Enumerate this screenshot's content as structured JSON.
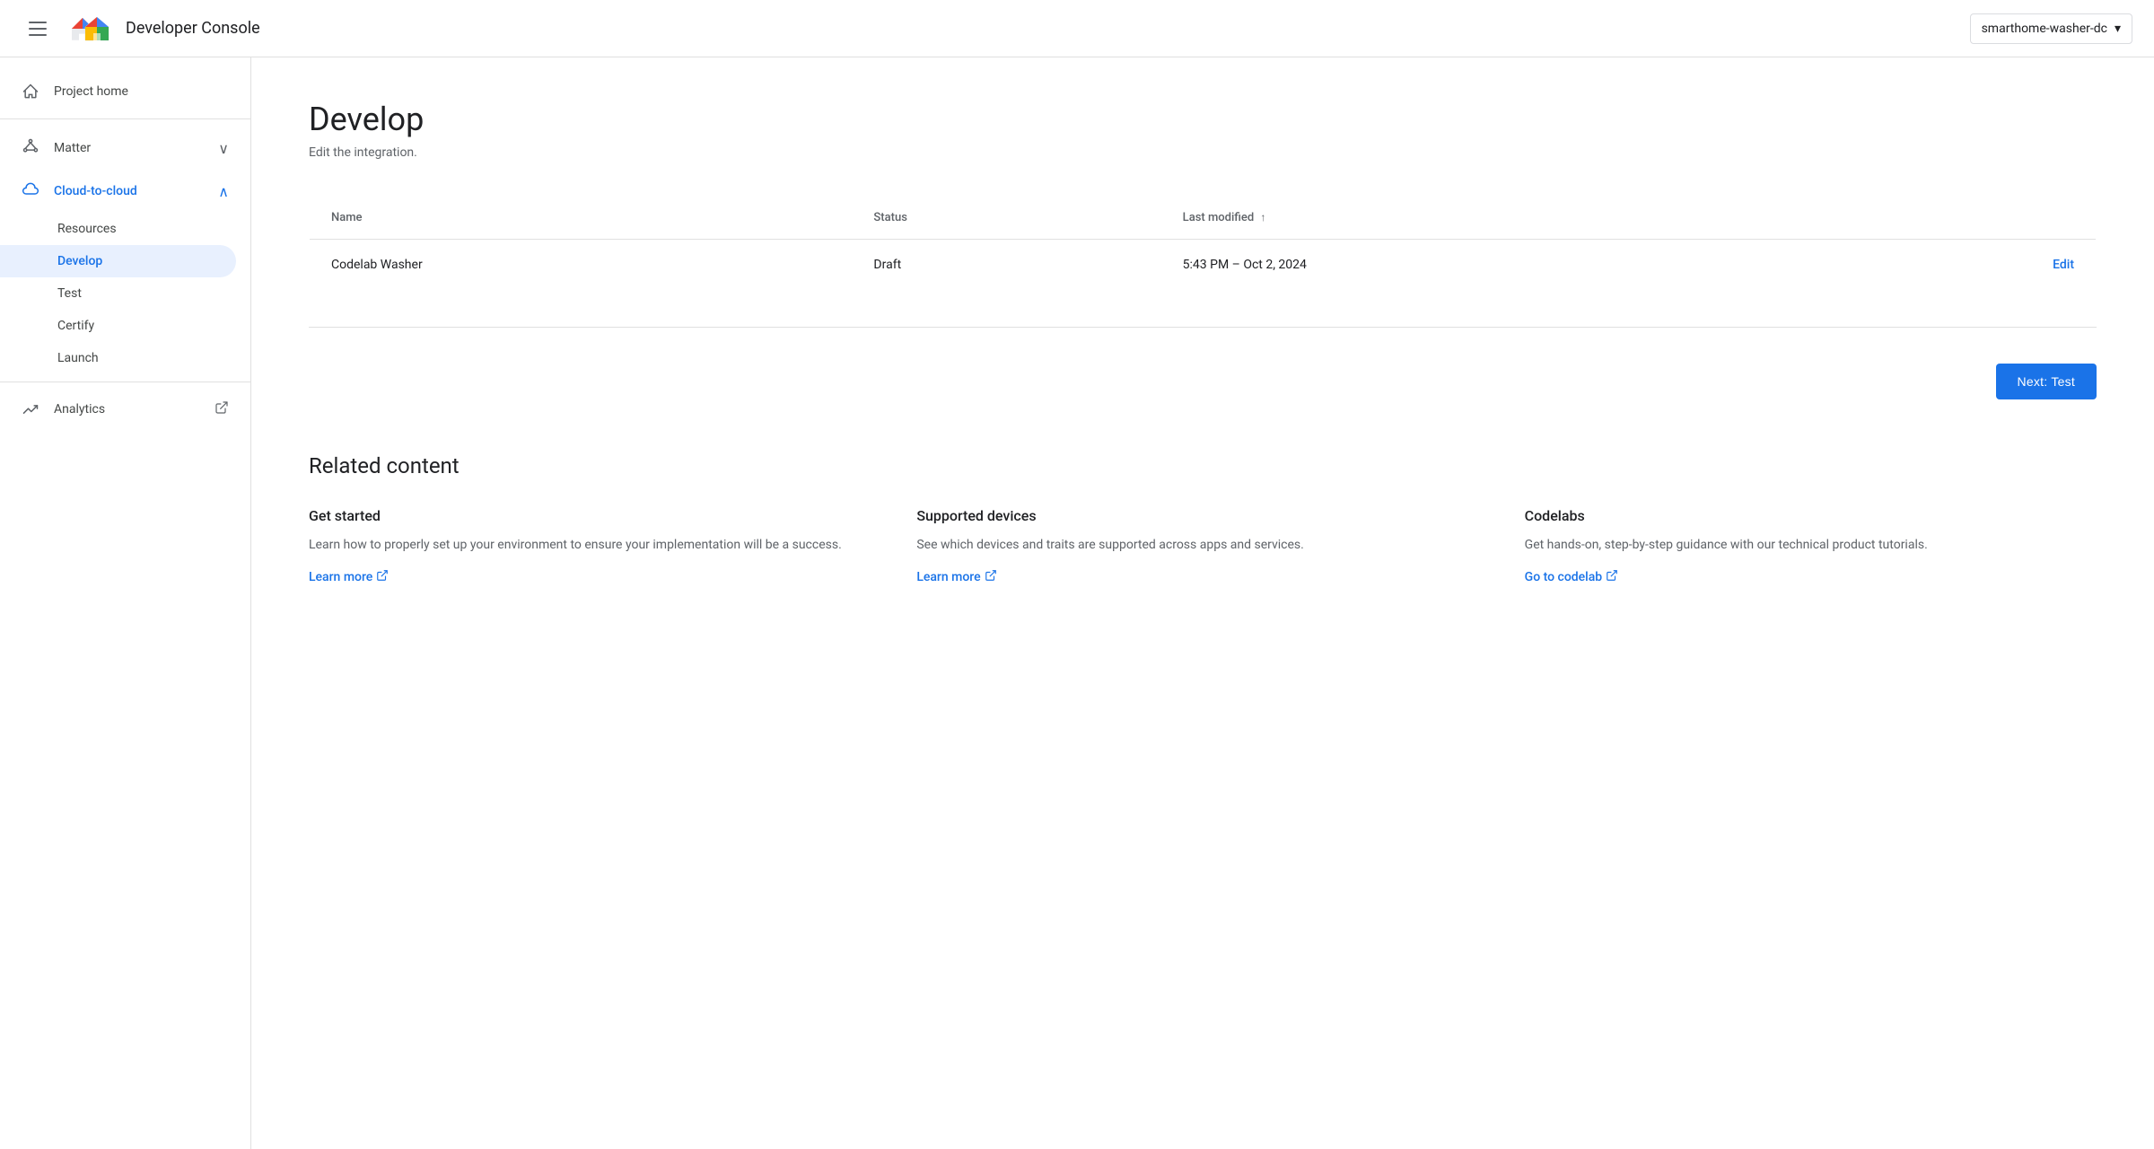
{
  "topbar": {
    "app_title": "Developer Console",
    "project": "smarthome-washer-dc",
    "dropdown_icon": "▾"
  },
  "sidebar": {
    "project_home_label": "Project home",
    "matter_label": "Matter",
    "cloud_to_cloud_label": "Cloud-to-cloud",
    "resources_label": "Resources",
    "develop_label": "Develop",
    "test_label": "Test",
    "certify_label": "Certify",
    "launch_label": "Launch",
    "analytics_label": "Analytics"
  },
  "main": {
    "page_title": "Develop",
    "page_subtitle": "Edit the integration.",
    "table": {
      "col_name": "Name",
      "col_status": "Status",
      "col_last_modified": "Last modified",
      "rows": [
        {
          "name": "Codelab Washer",
          "status": "Draft",
          "last_modified": "5:43 PM – Oct 2, 2024",
          "edit_label": "Edit"
        }
      ]
    },
    "next_button_label": "Next: Test",
    "related_content_title": "Related content",
    "related_cards": [
      {
        "title": "Get started",
        "description": "Learn how to properly set up your environment to ensure your implementation will be a success.",
        "link_label": "Learn more",
        "link_icon": "↗"
      },
      {
        "title": "Supported devices",
        "description": "See which devices and traits are supported across apps and services.",
        "link_label": "Learn more",
        "link_icon": "↗"
      },
      {
        "title": "Codelabs",
        "description": "Get hands-on, step-by-step guidance with our technical product tutorials.",
        "link_label": "Go to codelab",
        "link_icon": "↗"
      }
    ]
  }
}
